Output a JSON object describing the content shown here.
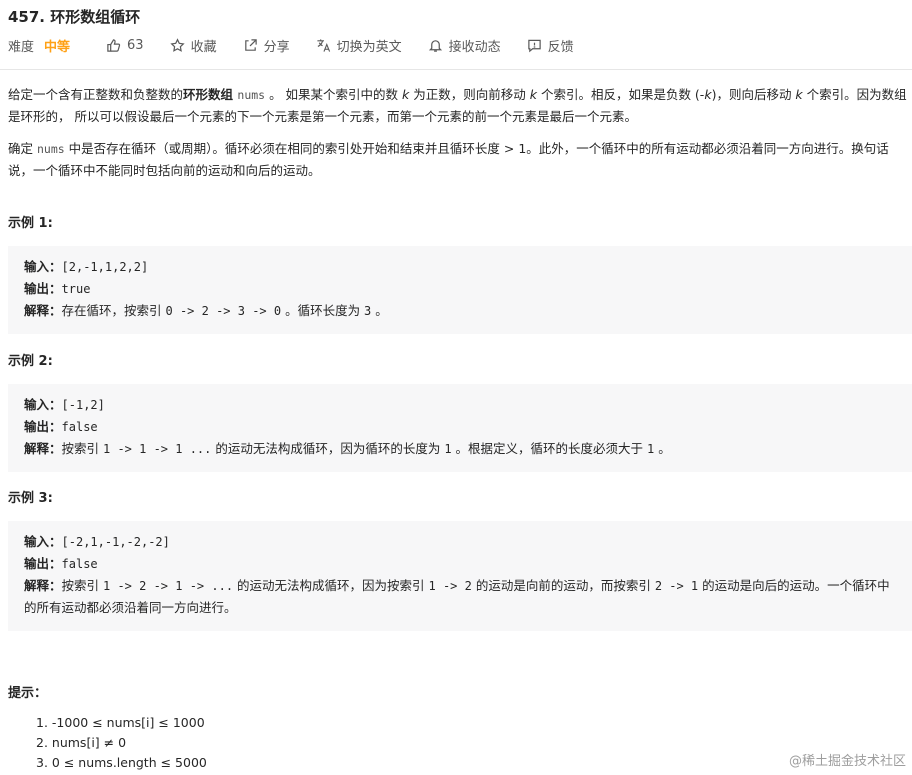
{
  "problem": {
    "title": "457. 环形数组循环"
  },
  "toolbar": {
    "difficulty_label": "难度",
    "difficulty_value": "中等",
    "likes": "63",
    "favorite": "收藏",
    "share": "分享",
    "switch_lang": "切换为英文",
    "notify": "接收动态",
    "feedback": "反馈",
    "colors": {
      "difficulty": "#ffa116",
      "icon": "#5a5a5a"
    }
  },
  "description": {
    "p1_a": "给定一个含有正整数和负整数的",
    "p1_bold": "环形",
    "p1_b": "数组 ",
    "p1_code": "nums",
    "p1_c": " 。 如果某个索引中的数 ",
    "p1_k1": "k",
    "p1_d": " 为正数，则向前移动 ",
    "p1_k2": "k",
    "p1_e": " 个索引。相反，如果是负数 (-",
    "p1_k3": "k",
    "p1_f": ")，则向后移动 ",
    "p1_k4": "k",
    "p1_g": " 个索引。因为数组是环形的， 所以可以假设最后一个元素的下一个元素是第一个元素，而第一个元素的前一个元素是最后一个元素。",
    "p2_a": "确定 ",
    "p2_code": "nums",
    "p2_b": " 中是否存在循环（或周期）。循环必须在相同的索引处开始和结束并且循环长度 > 1。此外，一个循环中的所有运动都必须沿着同一方向进行。换句话说，一个循环中不能同时包括向前的运动和向后的运动。"
  },
  "labels": {
    "input": "输入：",
    "output": "输出：",
    "explain": "解释："
  },
  "examples": [
    {
      "heading": "示例 1:",
      "input": "[2,-1,1,2,2]",
      "output": "true",
      "explanation_a": "存在循环，按索引 ",
      "explanation_code": "0 -> 2 -> 3 -> 0",
      "explanation_b": " 。循环长度为 ",
      "explanation_code2": "3",
      "explanation_c": " 。"
    },
    {
      "heading": "示例 2:",
      "input": "[-1,2]",
      "output": "false",
      "explanation_a": "按索引 ",
      "explanation_code": "1 -> 1 -> 1 ...",
      "explanation_b": " 的运动无法构成循环，因为循环的长度为 ",
      "explanation_code2": "1",
      "explanation_c": " 。根据定义，循环的长度必须大于 ",
      "explanation_code3": "1",
      "explanation_d": " 。"
    },
    {
      "heading": "示例 3:",
      "input": "[-2,1,-1,-2,-2]",
      "output": "false",
      "explanation_a": "按索引 ",
      "explanation_code": "1 -> 2 -> 1 -> ...",
      "explanation_b": " 的运动无法构成循环，因为按索引 ",
      "explanation_code2": "1 -> 2",
      "explanation_c": " 的运动是向前的运动，而按索引 ",
      "explanation_code3": "2 -> 1",
      "explanation_d": " 的运动是向后的运动。一个循环中的所有运动都必须沿着同一方向进行。"
    }
  ],
  "hints": {
    "heading": "提示：",
    "items": [
      "-1000 ≤ nums[i] ≤ 1000",
      "nums[i] ≠ 0",
      "0 ≤ nums.length ≤ 5000"
    ]
  },
  "watermark": "@稀土掘金技术社区"
}
